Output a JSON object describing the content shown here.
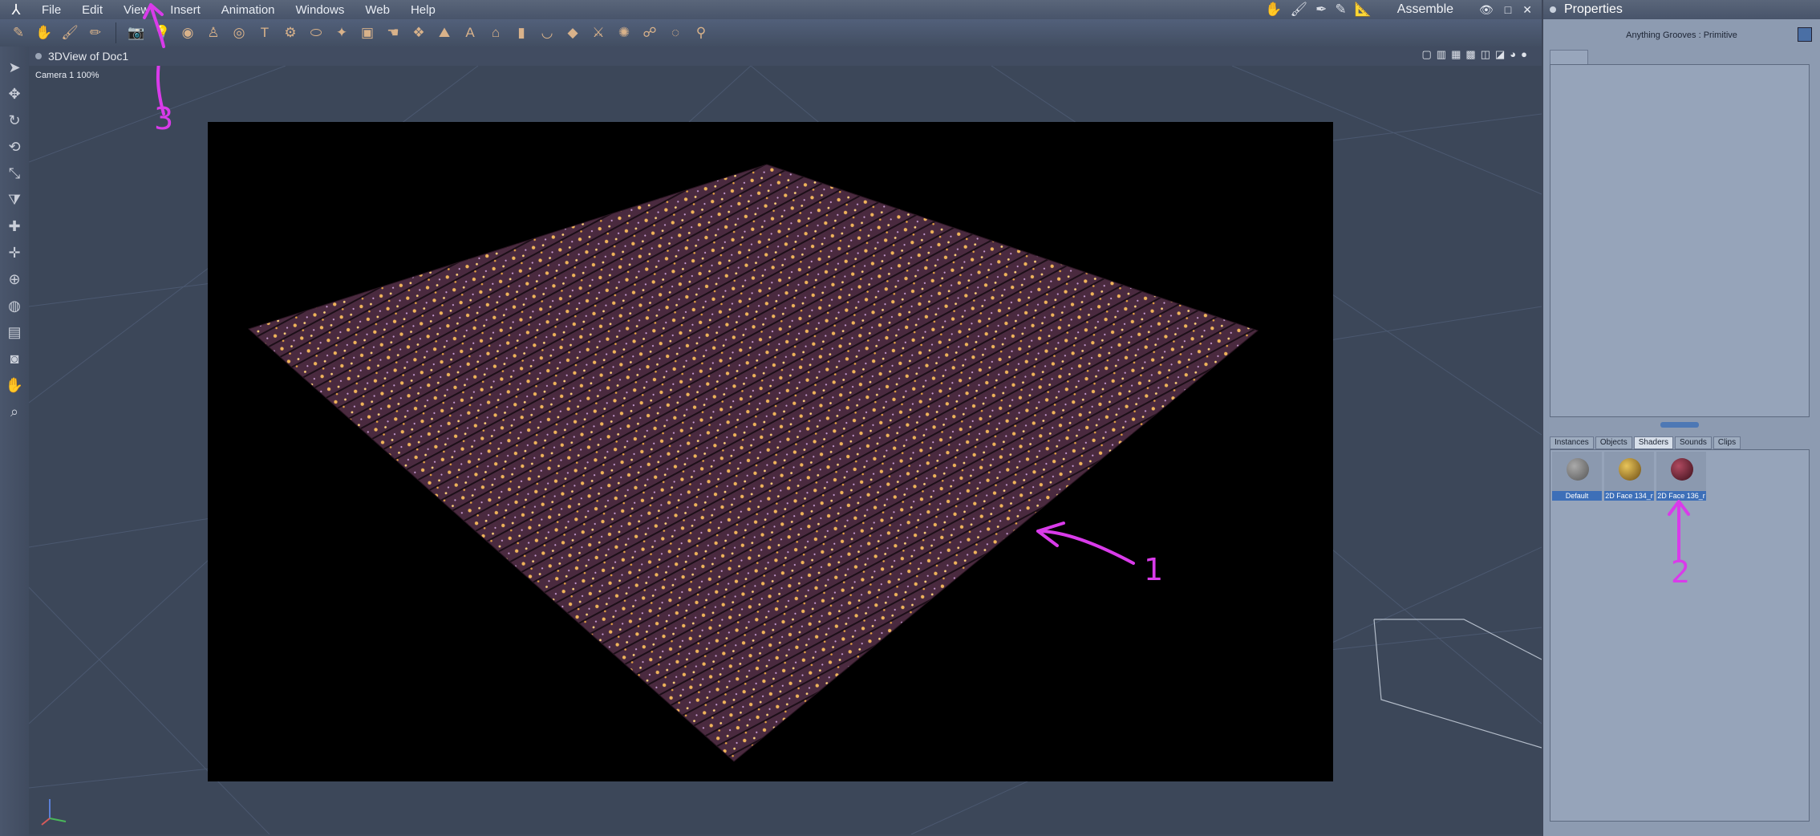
{
  "menubar": {
    "items": [
      "File",
      "Edit",
      "View",
      "Insert",
      "Animation",
      "Windows",
      "Web",
      "Help"
    ],
    "room_label": "Assemble",
    "room_icons": [
      "hand-icon",
      "brush-icon",
      "quill-icon",
      "pen-icon",
      "ruler-icon"
    ],
    "window_controls": [
      "👁",
      "□",
      "✕"
    ]
  },
  "toolbar": {
    "icons": [
      "select-icon",
      "hand-tool-icon",
      "brush-tool-icon",
      "pencil-tool-icon",
      "camera-icon",
      "light-icon",
      "sphere-icon",
      "figure-icon",
      "torus-icon",
      "text-icon",
      "gear-icon",
      "cylinder-icon",
      "vertex-icon",
      "cube-icon",
      "hand-icon",
      "shape-icon",
      "terrain-icon",
      "text3d-icon",
      "house-icon",
      "pillar-icon",
      "bowl-icon",
      "gem-icon",
      "sword-icon",
      "spider-icon",
      "network-icon",
      "ring-icon",
      "bone-icon"
    ]
  },
  "left_tools": [
    "arrow-icon",
    "move-icon",
    "rotate-icon",
    "twist-icon",
    "scale-icon",
    "taper-icon",
    "translate-icon",
    "pan-icon",
    "orbit-icon",
    "sphere-nav-icon",
    "layers-icon",
    "camera-icon",
    "hand-icon",
    "zoom-icon"
  ],
  "viewport": {
    "title": "3DView of Doc1",
    "camera_label": "Camera 1 100%",
    "axis_label": "x y z"
  },
  "annotations": [
    "1",
    "2",
    "3"
  ],
  "properties": {
    "title": "Properties",
    "object_name": "Anything Grooves : Primitive"
  },
  "library": {
    "tabs": [
      "Instances",
      "Objects",
      "Shaders",
      "Sounds",
      "Clips"
    ],
    "active_tab": "Shaders",
    "shaders": [
      {
        "label": "Default",
        "color": "#777777"
      },
      {
        "label": "2D Face 134_r",
        "color": "#b8902a"
      },
      {
        "label": "2D Face 136_r",
        "color": "#7a2a3a"
      }
    ]
  },
  "colors": {
    "accent": "#d93bea",
    "plane": "#4a2a3f",
    "selection": "#3d6fb8"
  }
}
